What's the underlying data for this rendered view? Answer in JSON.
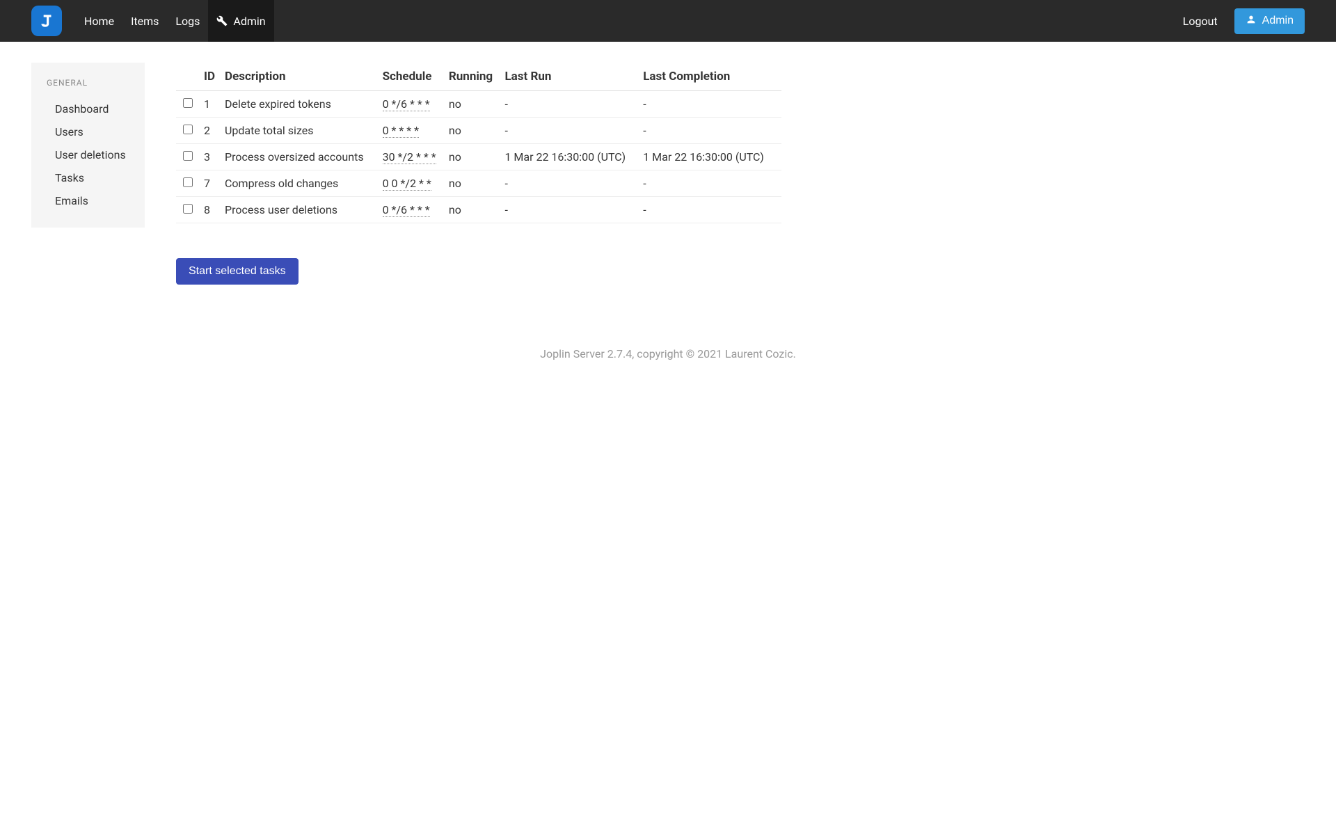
{
  "nav": {
    "home": "Home",
    "items": "Items",
    "logs": "Logs",
    "admin": "Admin",
    "logout": "Logout",
    "admin_button": "Admin"
  },
  "sidebar": {
    "heading": "GENERAL",
    "items": [
      {
        "label": "Dashboard"
      },
      {
        "label": "Users"
      },
      {
        "label": "User deletions"
      },
      {
        "label": "Tasks"
      },
      {
        "label": "Emails"
      }
    ]
  },
  "table": {
    "headers": {
      "id": "ID",
      "description": "Description",
      "schedule": "Schedule",
      "running": "Running",
      "last_run": "Last Run",
      "last_completion": "Last Completion"
    },
    "rows": [
      {
        "id": "1",
        "description": "Delete expired tokens",
        "schedule": "0 */6 * * *",
        "running": "no",
        "last_run": "-",
        "last_completion": "-"
      },
      {
        "id": "2",
        "description": "Update total sizes",
        "schedule": "0 * * * *",
        "running": "no",
        "last_run": "-",
        "last_completion": "-"
      },
      {
        "id": "3",
        "description": "Process oversized accounts",
        "schedule": "30 */2 * * *",
        "running": "no",
        "last_run": "1 Mar 22 16:30:00 (UTC)",
        "last_completion": "1 Mar 22 16:30:00 (UTC)"
      },
      {
        "id": "7",
        "description": "Compress old changes",
        "schedule": "0 0 */2 * *",
        "running": "no",
        "last_run": "-",
        "last_completion": "-"
      },
      {
        "id": "8",
        "description": "Process user deletions",
        "schedule": "0 */6 * * *",
        "running": "no",
        "last_run": "-",
        "last_completion": "-"
      }
    ]
  },
  "buttons": {
    "start_tasks": "Start selected tasks"
  },
  "footer": "Joplin Server 2.7.4, copyright © 2021 Laurent Cozic."
}
